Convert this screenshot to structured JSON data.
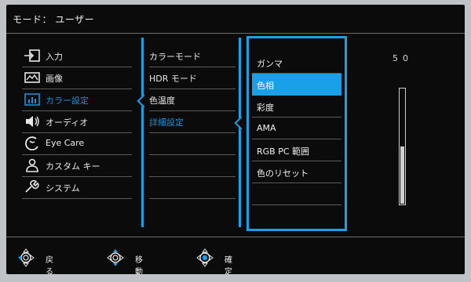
{
  "mode": {
    "label": "モード： ユーザー"
  },
  "main_menu": [
    {
      "label": "入力",
      "icon": "input-icon",
      "active": false
    },
    {
      "label": "画像",
      "icon": "picture-icon",
      "active": false
    },
    {
      "label": "カラー設定",
      "icon": "color-settings-icon",
      "active": true
    },
    {
      "label": "オーディオ",
      "icon": "speaker-icon",
      "active": false
    },
    {
      "label": "Eye Care",
      "icon": "eye-care-icon",
      "active": false
    },
    {
      "label": "カスタム キー",
      "icon": "person-icon",
      "active": false
    },
    {
      "label": "システム",
      "icon": "wrench-icon",
      "active": false
    }
  ],
  "sub_menu": [
    {
      "label": "カラーモード",
      "active": false
    },
    {
      "label": "HDR モード",
      "active": false
    },
    {
      "label": "色温度",
      "active": false
    },
    {
      "label": "詳細設定",
      "active": true
    }
  ],
  "detail_menu": [
    {
      "label": "ガンマ",
      "highlighted": false
    },
    {
      "label": "色相",
      "highlighted": true
    },
    {
      "label": "彩度",
      "highlighted": false
    },
    {
      "label": "AMA",
      "highlighted": false
    },
    {
      "label": "RGB PC 範囲",
      "highlighted": false
    },
    {
      "label": "色のリセット",
      "highlighted": false
    }
  ],
  "value_display": {
    "value": "50",
    "level": 0.5
  },
  "footer": {
    "back_label": "戻る",
    "move_label": "移動",
    "confirm_label": "確定"
  },
  "colors": {
    "accent": "#19a0e6",
    "background": "#0b0b0c",
    "text": "#e8e8e8"
  }
}
